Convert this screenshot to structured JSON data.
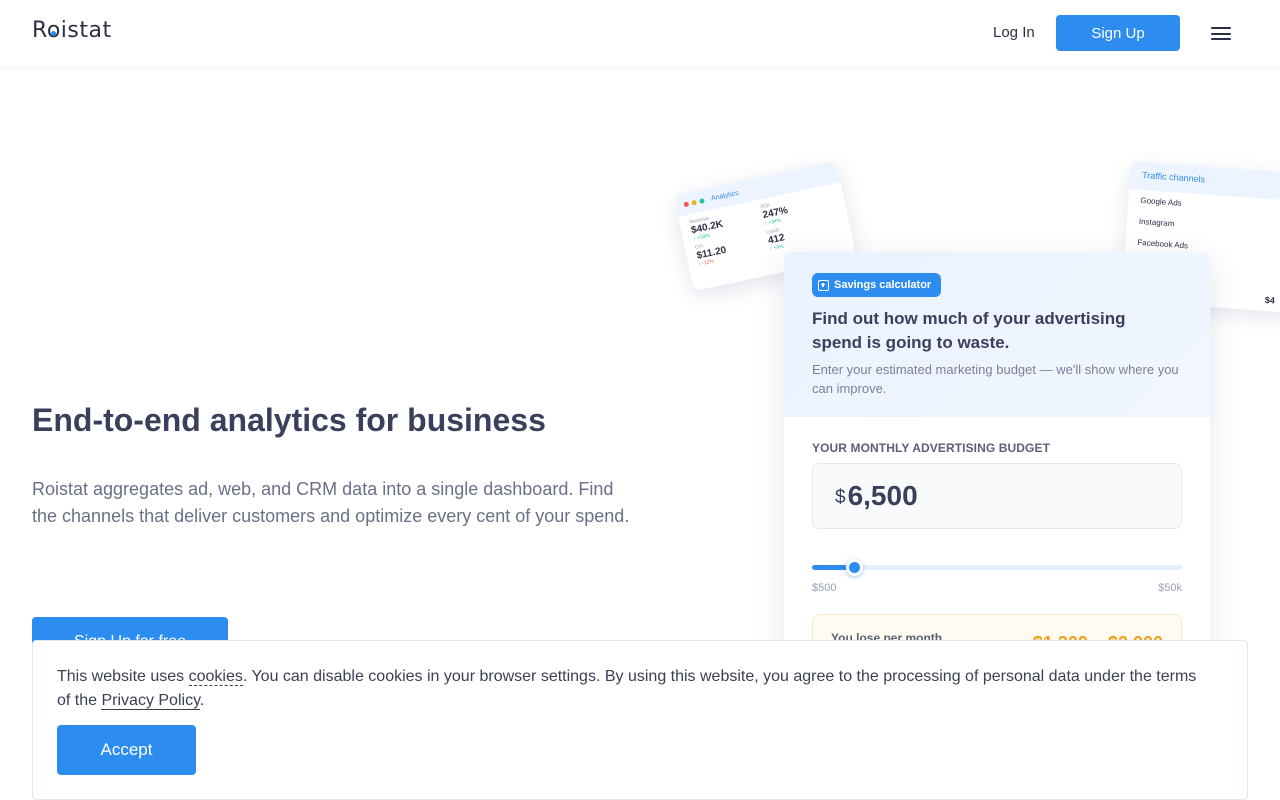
{
  "header": {
    "logo": "Roistat",
    "login_label": "Log In",
    "signup_label": "Sign Up"
  },
  "hero": {
    "title": "End-to-end analytics for business",
    "text": "Roistat aggregates ad, web, and CRM data into a single dashboard. Find the channels that deliver customers and optimize every cent of your spend.",
    "cta_label": "Sign Up for free"
  },
  "analytics_card": {
    "title": "Analytics",
    "metrics": [
      {
        "label": "Revenue",
        "value": "$40.2K",
        "delta": "↑ +18%"
      },
      {
        "label": "ROI",
        "value": "247%",
        "delta": "↑ +34%"
      },
      {
        "label": "CPL",
        "value": "$11.20",
        "delta": "↓ -12%"
      },
      {
        "label": "Leads",
        "value": "412",
        "delta": "↑ +9%"
      }
    ]
  },
  "traffic_card": {
    "title": "Traffic channels",
    "channels": [
      "Google Ads",
      "Instagram",
      "Facebook Ads"
    ],
    "amount": "$4"
  },
  "calculator": {
    "badge": "Savings calculator",
    "title": "Find out how much of your advertising spend is going to waste.",
    "subtitle": "Enter your estimated marketing budget — we'll show where you can improve.",
    "budget_label": "YOUR MONTHLY ADVERTISING BUDGET",
    "currency": "$",
    "budget_value": "6,500",
    "slider_min": "$500",
    "slider_max": "$50k",
    "slider_fraction": 0.115,
    "lose_label": "You lose per month",
    "lose_value": "$1,300 – $2,000"
  },
  "cookie": {
    "text_1": "This website uses ",
    "link_cookies": "cookies",
    "text_2": ". You can disable cookies in your browser settings. By using this website, you agree to the processing of personal data under the terms of the ",
    "link_privacy": "Privacy Policy",
    "text_3": ".",
    "accept_label": "Accept"
  },
  "colors": {
    "accent": "#2d8cf0",
    "heading": "#3a3f5c",
    "warning": "#f0a020"
  }
}
